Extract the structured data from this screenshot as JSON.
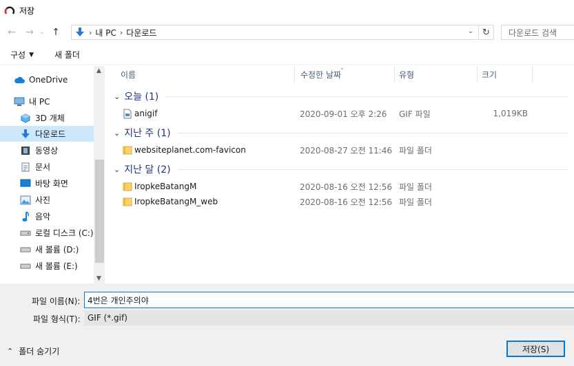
{
  "window": {
    "title": "저장"
  },
  "nav": {
    "breadcrumb": [
      "내 PC",
      "다운로드"
    ],
    "search_placeholder": "다운로드 검색"
  },
  "toolbar": {
    "organize_label": "구성",
    "new_folder_label": "새 폴더"
  },
  "sidebar": {
    "items": [
      {
        "label": "OneDrive",
        "icon": "cloud-icon"
      },
      {
        "label": "내 PC",
        "icon": "computer-icon"
      },
      {
        "label": "3D 개체",
        "icon": "cube-icon"
      },
      {
        "label": "다운로드",
        "icon": "download-arrow-icon",
        "selected": true
      },
      {
        "label": "동영상",
        "icon": "film-icon"
      },
      {
        "label": "문서",
        "icon": "document-icon"
      },
      {
        "label": "바탕 화면",
        "icon": "desktop-icon"
      },
      {
        "label": "사진",
        "icon": "picture-icon"
      },
      {
        "label": "음악",
        "icon": "music-note-icon"
      },
      {
        "label": "로컬 디스크 (C:)",
        "icon": "drive-icon"
      },
      {
        "label": "새 볼륨 (D:)",
        "icon": "drive-icon"
      },
      {
        "label": "새 볼륨 (E:)",
        "icon": "drive-icon"
      }
    ]
  },
  "columns": {
    "name": "이름",
    "modified": "수정한 날짜",
    "type": "유형",
    "size": "크기"
  },
  "groups": [
    {
      "label": "오늘 (1)",
      "files": [
        {
          "name": "anigif",
          "modified": "2020-09-01 오후 2:26",
          "type": "GIF 파일",
          "size": "1,019KB",
          "icon": "gif-file-icon"
        }
      ]
    },
    {
      "label": "지난 주 (1)",
      "files": [
        {
          "name": "websiteplanet.com-favicon",
          "modified": "2020-08-27 오전 11:46",
          "type": "파일 폴더",
          "size": "",
          "icon": "folder-icon"
        }
      ]
    },
    {
      "label": "지난 달 (2)",
      "files": [
        {
          "name": "IropkeBatangM",
          "modified": "2020-08-16 오전 12:56",
          "type": "파일 폴더",
          "size": "",
          "icon": "folder-icon"
        },
        {
          "name": "IropkeBatangM_web",
          "modified": "2020-08-16 오전 12:56",
          "type": "파일 폴더",
          "size": "",
          "icon": "folder-icon"
        }
      ]
    }
  ],
  "footer": {
    "filename_label": "파일 이름(N):",
    "filename_value": "4번은 개인주의야",
    "filetype_label": "파일 형식(T):",
    "filetype_value": "GIF (*.gif)",
    "hide_folders_label": "폴더 숨기기",
    "save_label": "저장(S)"
  },
  "colors": {
    "selected_bg": "#cce8ff",
    "accent": "#0078d7",
    "group_text": "#1e3287",
    "folder": "#ffd36b"
  }
}
